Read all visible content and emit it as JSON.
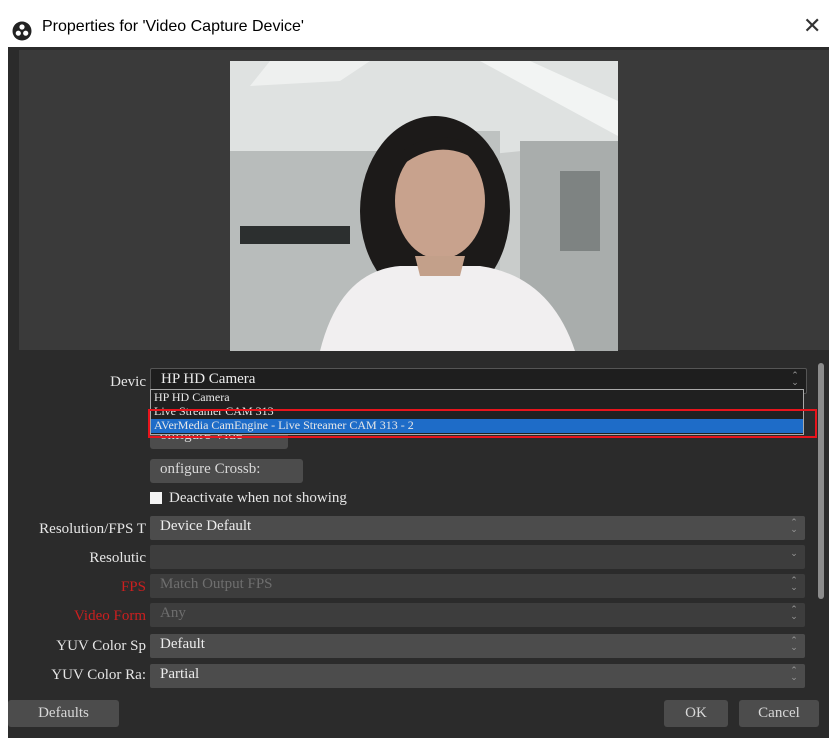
{
  "window": {
    "title": "Properties for 'Video Capture Device'",
    "close_glyph": "✕"
  },
  "form": {
    "device_label": "Devic",
    "device_value": "HP HD Camera",
    "device_options": [
      "HP HD Camera",
      "Live Streamer CAM 313",
      "AVerMedia CamEngine - Live Streamer CAM 313 - 2"
    ],
    "device_selected_index": 2,
    "configure_video_button": "onfigure Vide",
    "configure_crossbar_button": "onfigure Crossb:",
    "deactivate_label": "Deactivate when not showing",
    "deactivate_checked": false,
    "resolution_fps_type_label": "Resolution/FPS T",
    "resolution_fps_type_value": "Device Default",
    "resolution_label": "Resolutic",
    "resolution_value": "",
    "fps_label": "FPS",
    "fps_value": "Match Output FPS",
    "video_format_label": "Video Form",
    "video_format_value": "Any",
    "yuv_color_space_label": "YUV Color Sp",
    "yuv_color_space_value": "Default",
    "yuv_color_range_label": "YUV Color Ra:",
    "yuv_color_range_value": "Partial"
  },
  "footer": {
    "defaults_button": "Defaults",
    "ok_button": "OK",
    "cancel_button": "Cancel"
  },
  "colors": {
    "dialog_background": "#2b2b2b",
    "highlight_blue": "#1e6cc8",
    "annotation_red": "#e8141c",
    "disabled_label_red": "#cc1f1f"
  }
}
